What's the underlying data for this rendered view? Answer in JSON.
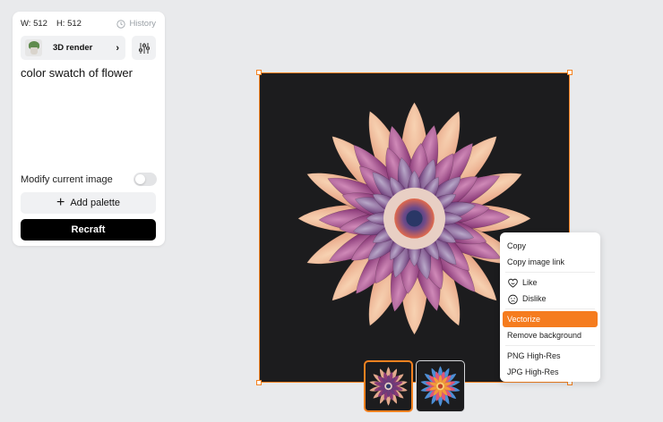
{
  "panel": {
    "width_label": "W: 512",
    "height_label": "H: 512",
    "history_label": "History",
    "history_icon": "clock-icon",
    "style_label": "3D render",
    "style_icon": "chevron-right-icon",
    "settings_icon": "sliders-icon",
    "prompt_text": "color swatch of flower",
    "modify_label": "Modify current image",
    "modify_enabled": false,
    "add_palette_label": "Add palette",
    "recraft_label": "Recraft"
  },
  "context_menu": {
    "items": [
      {
        "label": "Copy"
      },
      {
        "label": "Copy image link"
      },
      {
        "label": "Like",
        "icon": "heart-face-icon"
      },
      {
        "label": "Dislike",
        "icon": "sad-face-icon"
      },
      {
        "label": "Vectorize",
        "active": true
      },
      {
        "label": "Remove background"
      },
      {
        "label": "PNG High-Res"
      },
      {
        "label": "JPG High-Res"
      }
    ]
  },
  "colors": {
    "accent": "#f58220",
    "menu_active": "#f57c1f",
    "button_dark": "#000000",
    "canvas_bg": "#1c1c1e"
  }
}
